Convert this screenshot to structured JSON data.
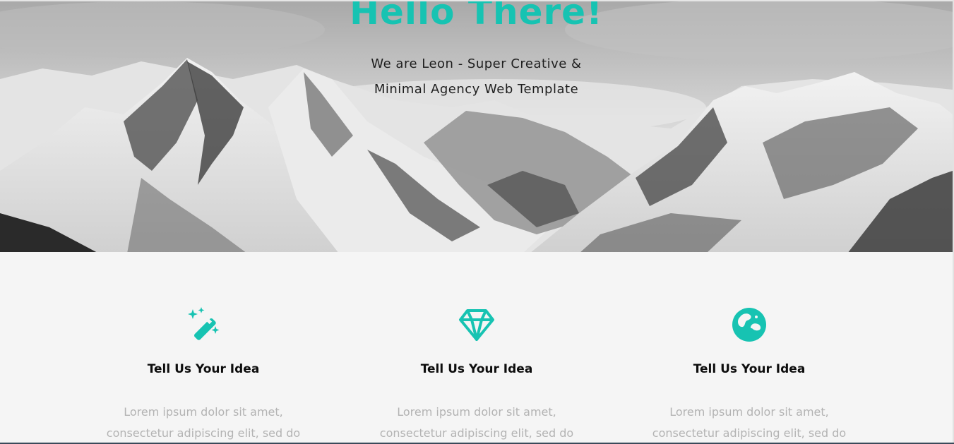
{
  "hero": {
    "title": "Hello There!",
    "subtitle_line1": "We are Leon - Super Creative &",
    "subtitle_line2": "Minimal Agency Web Template"
  },
  "features": [
    {
      "icon": "magic-wand-icon",
      "title": "Tell Us Your Idea",
      "text_line1": "Lorem ipsum dolor sit amet,",
      "text_line2": "consectetur adipiscing elit, sed do"
    },
    {
      "icon": "diamond-icon",
      "title": "Tell Us Your Idea",
      "text_line1": "Lorem ipsum dolor sit amet,",
      "text_line2": "consectetur adipiscing elit, sed do"
    },
    {
      "icon": "globe-icon",
      "title": "Tell Us Your Idea",
      "text_line1": "Lorem ipsum dolor sit amet,",
      "text_line2": "consectetur adipiscing elit, sed do"
    }
  ],
  "colors": {
    "accent": "#17c3b2",
    "heading": "#0d0d0d",
    "body_text": "#b3b3b3",
    "section_bg": "#f5f5f5"
  }
}
